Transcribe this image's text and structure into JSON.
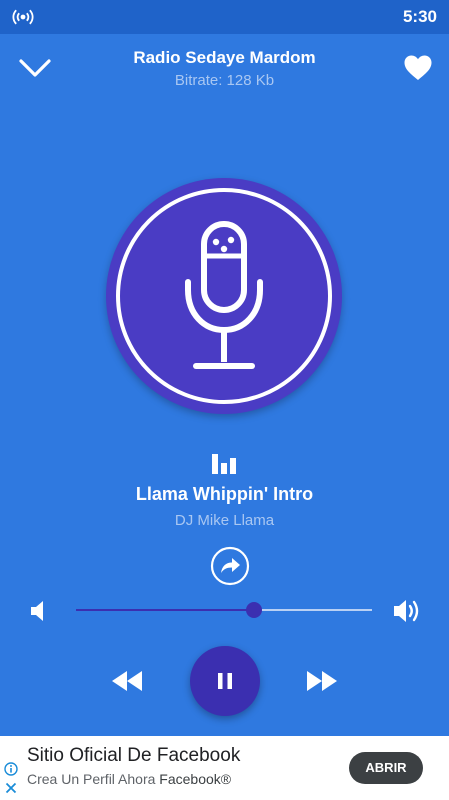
{
  "status_bar": {
    "time": "5:30"
  },
  "header": {
    "station_name": "Radio Sedaye Mardom",
    "bitrate": "Bitrate: 128 Kb"
  },
  "now_playing": {
    "title": "Llama Whippin' Intro",
    "artist": "DJ Mike Llama",
    "volume_level": 0.6
  },
  "icons": {
    "status": "radio-signal-icon",
    "collapse": "chevron-down-icon",
    "favorite": "heart-icon",
    "artwork": "microphone-icon",
    "equalizer": "equalizer-bars-icon",
    "share": "share-icon",
    "volume_low": "volume-low-icon",
    "volume_high": "volume-high-icon",
    "rewind": "rewind-icon",
    "pause": "pause-icon",
    "forward": "fast-forward-icon"
  },
  "colors": {
    "background": "#2f79e0",
    "status_bar": "#1f63c9",
    "accent": "#3b2fb0",
    "artwork": "#4a3cc4"
  },
  "ad": {
    "title": "Sitio Oficial De Facebook",
    "description": "Crea Un Perfil Ahora",
    "brand": "Facebook®",
    "cta": "ABRIR"
  }
}
